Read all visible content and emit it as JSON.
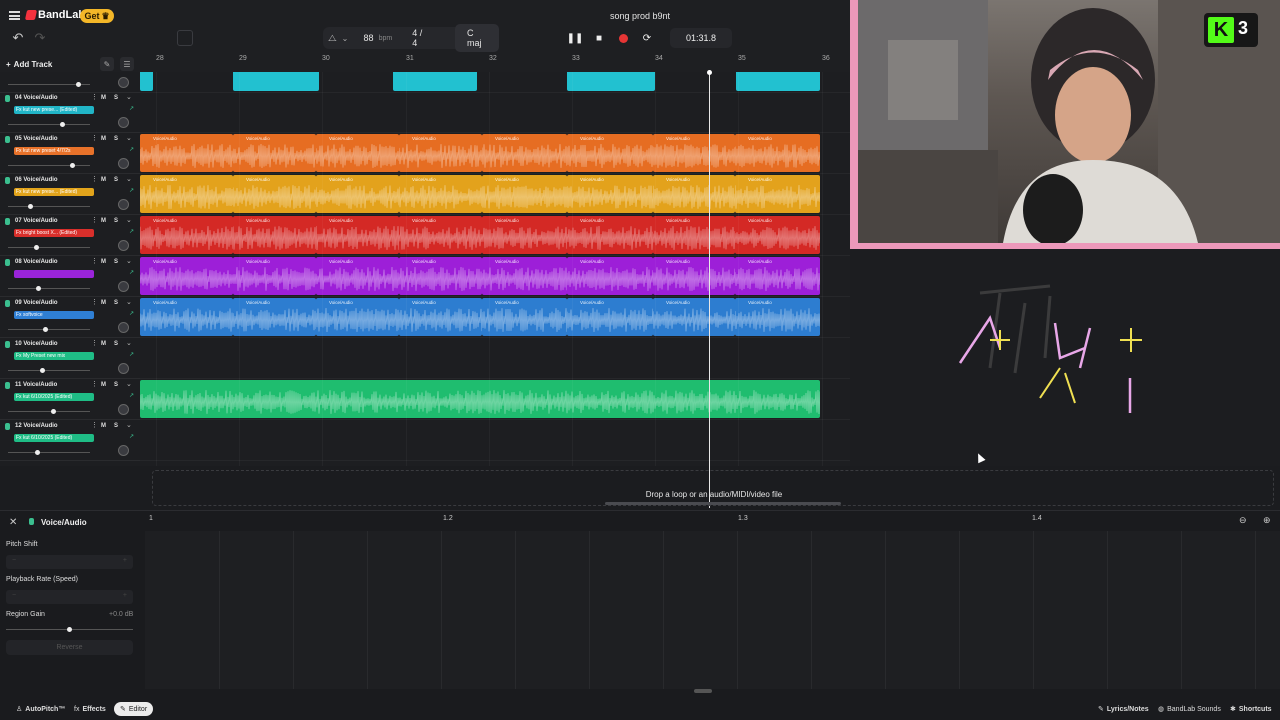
{
  "app": {
    "brand": "BandLab",
    "get_label": "Get",
    "song_title": "song prod b9nt"
  },
  "toolbar": {
    "bpm": "88",
    "bpm_unit": "bpm",
    "time_signature": "4 / 4",
    "key": "C maj",
    "time": "01:31.8",
    "add_track_label": "Add Track"
  },
  "ruler": [
    "28",
    "29",
    "30",
    "31",
    "32",
    "33",
    "34",
    "35",
    "36"
  ],
  "tracks": [
    {
      "name": "04 Voice/Audio",
      "fx": "Fx kut new prese... (Edited)",
      "fx_color": "#21b5c7",
      "clip_color": "#22c1d0"
    },
    {
      "name": "05 Voice/Audio",
      "fx": "Fx kut new preset 4/7/2s",
      "fx_color": "#e8722a",
      "clip_color": "#e66d22"
    },
    {
      "name": "06 Voice/Audio",
      "fx": "Fx kut new prese... (Edited)",
      "fx_color": "#e2a41b",
      "clip_color": "#e3a21c"
    },
    {
      "name": "07 Voice/Audio",
      "fx": "Fx bright boost X... (Edited)",
      "fx_color": "#d92f2b",
      "clip_color": "#d42925"
    },
    {
      "name": "08 Voice/Audio",
      "fx": "",
      "fx_color": "#9a24d9",
      "clip_color": "#9d1fd8"
    },
    {
      "name": "09 Voice/Audio",
      "fx": "Fx softvoice",
      "fx_color": "#2f7fd4",
      "clip_color": "#2d7dd0"
    },
    {
      "name": "10 Voice/Audio",
      "fx": "Fx My Preset new mix",
      "fx_color": "#1fbd86",
      "clip_color": "#1fbd86"
    },
    {
      "name": "11 Voice/Audio",
      "fx": "Fx kut 6/10/2025 (Edited)",
      "fx_color": "#1fbd86",
      "clip_color": "#1fbd6f"
    },
    {
      "name": "12 Voice/Audio",
      "fx": "Fx kut 6/10/2025 (Edited)",
      "fx_color": "#1fbd86",
      "clip_color": "#1fbd6f"
    }
  ],
  "clip_label": "Voice/Audio",
  "drop_text": "Drop a loop or an audio/MIDI/video file",
  "editor": {
    "track": "Voice/Audio",
    "pitch_shift": "Pitch Shift",
    "playback_rate": "Playback Rate (Speed)",
    "region_gain": "Region Gain",
    "region_gain_value": "+0.0 dB",
    "reverse": "Reverse",
    "minus": "−",
    "plus": "+",
    "ruler": [
      "1",
      "1.2",
      "1.3",
      "1.4"
    ]
  },
  "bottom": {
    "autopitch": "AutoPitch™",
    "effects": "Effects",
    "editor": "Editor",
    "lyrics": "Lyrics/Notes",
    "sounds": "BandLab Sounds",
    "shortcuts": "Shortcuts"
  },
  "webcam": {
    "badge_count": "3",
    "badge_letter": "K"
  },
  "icons": {
    "menu": "hamburger-icon",
    "undo": "undo-icon",
    "redo": "redo-icon",
    "pause": "pause-icon",
    "stop": "stop-icon",
    "record": "record-icon",
    "loop": "loop-icon",
    "metronome": "metronome-icon",
    "zoom_in": "zoom-in-icon",
    "zoom_out": "zoom-out-icon"
  }
}
